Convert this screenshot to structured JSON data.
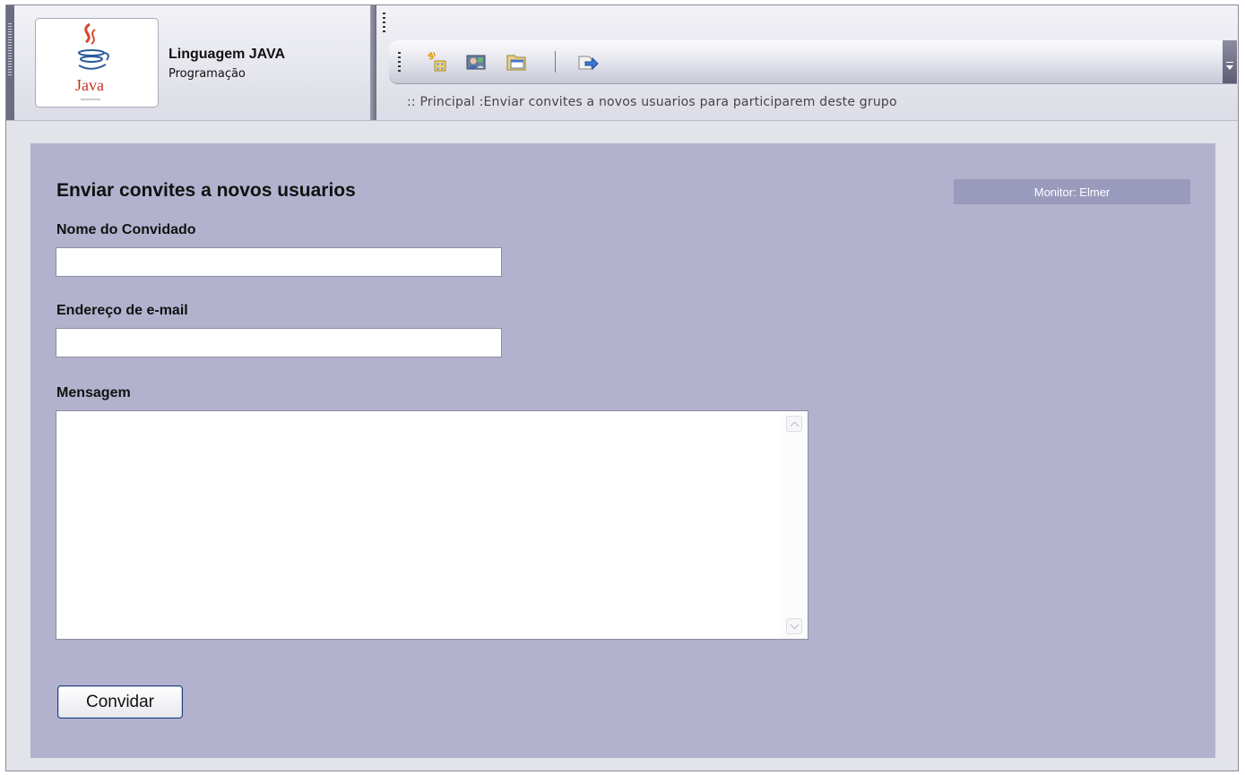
{
  "header": {
    "group_name": "Linguagem JAVA",
    "group_category": "Programação",
    "logo_text": "Java",
    "breadcrumb": ":: Principal :Enviar convites a novos usuarios para participarem deste grupo"
  },
  "toolbar": {
    "buttons": [
      {
        "icon": "new-items-icon"
      },
      {
        "icon": "contacts-icon"
      },
      {
        "icon": "folder-window-icon"
      },
      {
        "icon": "forward-icon"
      }
    ]
  },
  "form": {
    "title": "Enviar convites a novos usuarios",
    "monitor": "Monitor: Elmer",
    "name_label": "Nome do Convidado",
    "name_value": "",
    "email_label": "Endereço de e-mail",
    "email_value": "",
    "message_label": "Mensagem",
    "message_value": "",
    "submit_label": "Convidar"
  },
  "colors": {
    "panel": "#b2b2ce",
    "monitor_badge": "#9a9abd",
    "header_background": "#e3e3ea"
  }
}
